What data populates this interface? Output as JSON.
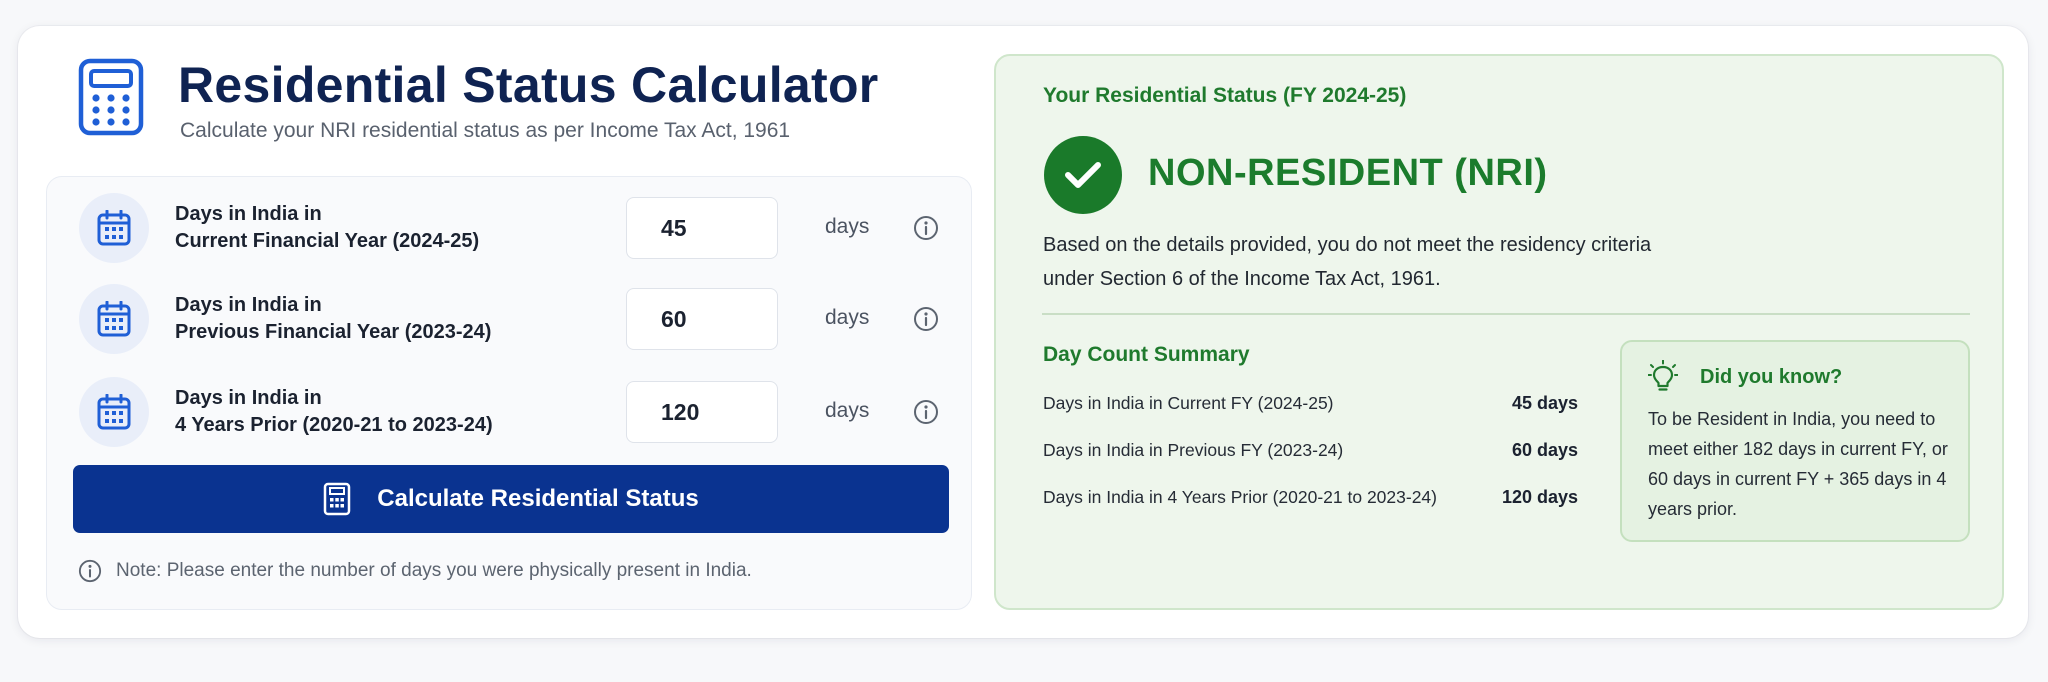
{
  "header": {
    "title": "Residential Status Calculator",
    "subtitle": "Calculate your NRI residential status as per Income Tax Act, 1961",
    "icon": "calculator-icon"
  },
  "inputs": [
    {
      "label_line1": "Days in India in",
      "label_line2": "Current Financial Year (2024-25)",
      "value": "45",
      "unit": "days",
      "icon": "calendar-icon"
    },
    {
      "label_line1": "Days in India in",
      "label_line2": "Previous Financial Year (2023-24)",
      "value": "60",
      "unit": "days",
      "icon": "calendar-icon"
    },
    {
      "label_line1": "Days in India in",
      "label_line2": "4 Years Prior (2020-21 to 2023-24)",
      "value": "120",
      "unit": "days",
      "icon": "calendar-icon"
    }
  ],
  "calculate_button": {
    "label": "Calculate Residential Status",
    "icon": "calculator-icon"
  },
  "note": "Note: Please enter the number of days you were physically present in India.",
  "result": {
    "heading": "Your Residential Status (FY 2024-25)",
    "status": "NON-RESIDENT (NRI)",
    "description": "Based on the details provided, you do not meet the residency criteria under Section 6 of the Income Tax Act, 1961.",
    "summary_heading": "Day Count Summary",
    "summary": [
      {
        "label": "Days in India in Current FY (2024-25)",
        "value": "45 days"
      },
      {
        "label": "Days in India in Previous FY (2023-24)",
        "value": "60 days"
      },
      {
        "label": "Days in India in 4 Years Prior (2020-21 to 2023-24)",
        "value": "120 days"
      }
    ],
    "tip": {
      "title": "Did you know?",
      "text": "To be Resident in India, you need to meet either 182 days in current FY, or 60 days in current FY + 365 days in 4 years prior.",
      "icon": "lightbulb-icon"
    }
  },
  "colors": {
    "primary": "#0a3390",
    "title": "#0f2352",
    "success": "#1b7c2c",
    "success_bg": "#eef6ec"
  }
}
